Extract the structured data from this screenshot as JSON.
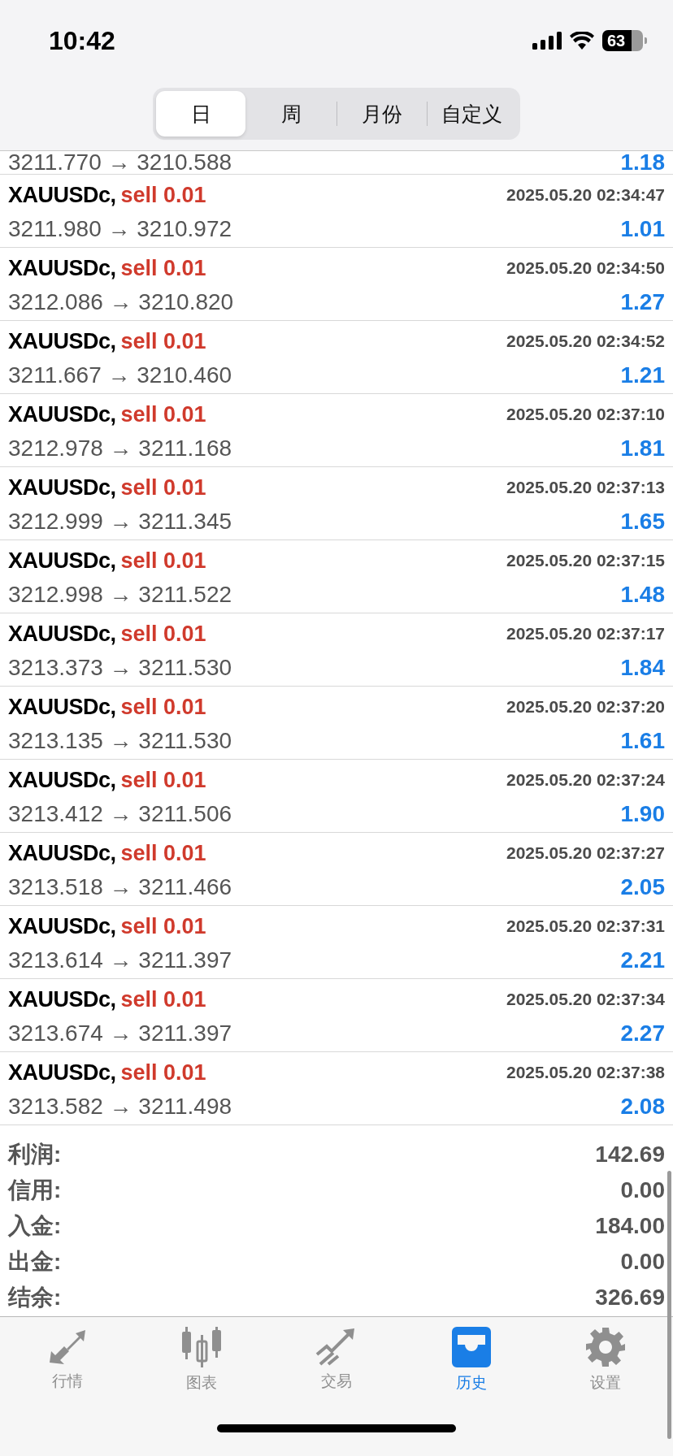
{
  "status_bar": {
    "time": "10:42",
    "battery": "63"
  },
  "period_tabs": [
    {
      "label": "日",
      "selected": true
    },
    {
      "label": "周",
      "selected": false
    },
    {
      "label": "月份",
      "selected": false
    },
    {
      "label": "自定义",
      "selected": false
    }
  ],
  "partial_row": {
    "prices": "3211.770 → 3210.588",
    "profit": "1.18"
  },
  "deals": [
    {
      "symbol": "XAUUSDc,",
      "kind": "sell",
      "order": "sell 0.01",
      "time": "2025.05.20 02:34:47",
      "prices": "3211.980 → 3210.972",
      "profit": "1.01"
    },
    {
      "symbol": "XAUUSDc,",
      "kind": "sell",
      "order": "sell 0.01",
      "time": "2025.05.20 02:34:50",
      "prices": "3212.086 → 3210.820",
      "profit": "1.27"
    },
    {
      "symbol": "XAUUSDc,",
      "kind": "sell",
      "order": "sell 0.01",
      "time": "2025.05.20 02:34:52",
      "prices": "3211.667 → 3210.460",
      "profit": "1.21"
    },
    {
      "symbol": "XAUUSDc,",
      "kind": "sell",
      "order": "sell 0.01",
      "time": "2025.05.20 02:37:10",
      "prices": "3212.978 → 3211.168",
      "profit": "1.81"
    },
    {
      "symbol": "XAUUSDc,",
      "kind": "sell",
      "order": "sell 0.01",
      "time": "2025.05.20 02:37:13",
      "prices": "3212.999 → 3211.345",
      "profit": "1.65"
    },
    {
      "symbol": "XAUUSDc,",
      "kind": "sell",
      "order": "sell 0.01",
      "time": "2025.05.20 02:37:15",
      "prices": "3212.998 → 3211.522",
      "profit": "1.48"
    },
    {
      "symbol": "XAUUSDc,",
      "kind": "sell",
      "order": "sell 0.01",
      "time": "2025.05.20 02:37:17",
      "prices": "3213.373 → 3211.530",
      "profit": "1.84"
    },
    {
      "symbol": "XAUUSDc,",
      "kind": "sell",
      "order": "sell 0.01",
      "time": "2025.05.20 02:37:20",
      "prices": "3213.135 → 3211.530",
      "profit": "1.61"
    },
    {
      "symbol": "XAUUSDc,",
      "kind": "sell",
      "order": "sell 0.01",
      "time": "2025.05.20 02:37:24",
      "prices": "3213.412 → 3211.506",
      "profit": "1.90"
    },
    {
      "symbol": "XAUUSDc,",
      "kind": "sell",
      "order": "sell 0.01",
      "time": "2025.05.20 02:37:27",
      "prices": "3213.518 → 3211.466",
      "profit": "2.05"
    },
    {
      "symbol": "XAUUSDc,",
      "kind": "sell",
      "order": "sell 0.01",
      "time": "2025.05.20 02:37:31",
      "prices": "3213.614 → 3211.397",
      "profit": "2.21"
    },
    {
      "symbol": "XAUUSDc,",
      "kind": "sell",
      "order": "sell 0.01",
      "time": "2025.05.20 02:37:34",
      "prices": "3213.674 → 3211.397",
      "profit": "2.27"
    },
    {
      "symbol": "XAUUSDc,",
      "kind": "sell",
      "order": "sell 0.01",
      "time": "2025.05.20 02:37:38",
      "prices": "3213.582 → 3211.498",
      "profit": "2.08"
    }
  ],
  "summary": [
    {
      "label": "利润:",
      "value": "142.69"
    },
    {
      "label": "信用:",
      "value": "0.00"
    },
    {
      "label": "入金:",
      "value": "184.00"
    },
    {
      "label": "出金:",
      "value": "0.00"
    },
    {
      "label": "结余:",
      "value": "326.69"
    }
  ],
  "bottom_tabs": [
    {
      "kind": "quotes",
      "label": "行情",
      "selected": false
    },
    {
      "kind": "chart",
      "label": "图表",
      "selected": false
    },
    {
      "kind": "trade",
      "label": "交易",
      "selected": false
    },
    {
      "kind": "history",
      "label": "历史",
      "selected": true
    },
    {
      "kind": "settings",
      "label": "设置",
      "selected": false
    }
  ]
}
